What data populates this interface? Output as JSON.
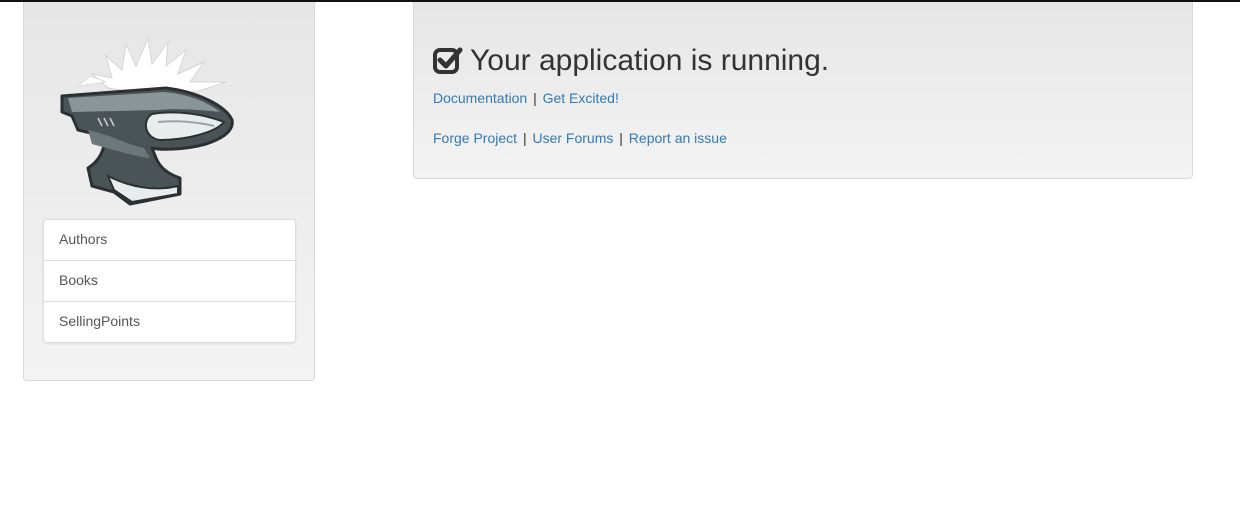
{
  "sidebar": {
    "logo_icon": "anvil-logo-icon",
    "nav_items": [
      {
        "label": "Authors"
      },
      {
        "label": "Books"
      },
      {
        "label": "SellingPoints"
      }
    ]
  },
  "main": {
    "status_icon": "check-square-icon",
    "headline": "Your application is running.",
    "links_row1": {
      "documentation": "Documentation",
      "separator": "|",
      "get_excited": "Get Excited!"
    },
    "links_row2": {
      "forge_project": "Forge Project",
      "separator1": "|",
      "user_forums": "User Forums",
      "separator2": "|",
      "report_issue": "Report an issue"
    }
  },
  "colors": {
    "link": "#337ab7",
    "text": "#333333",
    "panel_top": "#e6e6e6",
    "panel_bottom": "#f3f3f3"
  }
}
